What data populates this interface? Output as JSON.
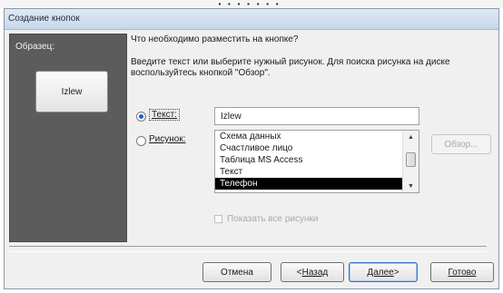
{
  "window": {
    "title": "Создание кнопок"
  },
  "sample": {
    "label": "Образец:",
    "button_text": "Izlew"
  },
  "prompt": {
    "question": "Что необходимо разместить на кнопке?",
    "instructions": "Введите текст или выберите нужный рисунок.  Для поиска рисунка на диске воспользуйтесь кнопкой \"Обзор\"."
  },
  "options": {
    "text_label": "Текст:",
    "text_selected": true,
    "text_value": "Izlew",
    "picture_label": "Рисунок:",
    "picture_selected": false
  },
  "picture_list": {
    "items": [
      "Схема данных",
      "Счастливое лицо",
      "Таблица MS Access",
      "Текст",
      "Телефон"
    ],
    "selected": "Телефон"
  },
  "browse_label": "Обзор...",
  "show_all_label": "Показать все рисунки",
  "buttons": {
    "cancel": "Отмена",
    "back_arrow": "< ",
    "back": "Назад",
    "next": "Далее",
    "next_arrow": " >",
    "done": "Готово"
  }
}
